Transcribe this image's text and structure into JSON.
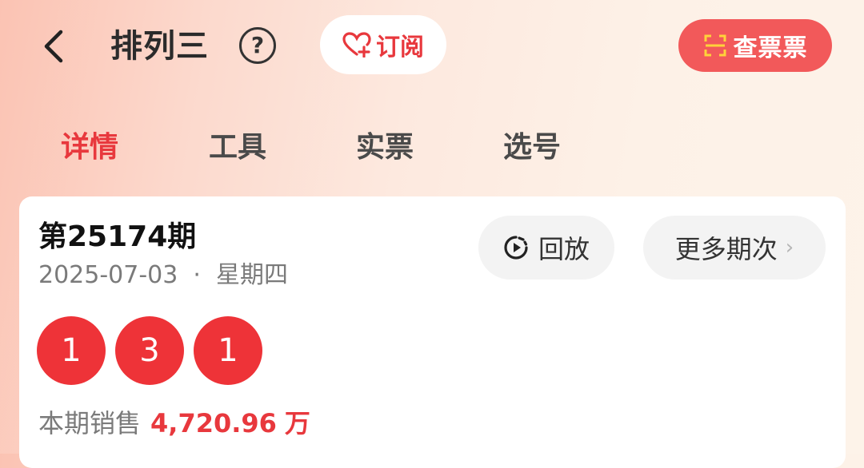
{
  "header": {
    "title": "排列三",
    "help": "?",
    "subscribe_label": "订阅",
    "check_ticket_label": "查票票"
  },
  "tabs": [
    {
      "label": "详情",
      "active": true
    },
    {
      "label": "工具",
      "active": false
    },
    {
      "label": "实票",
      "active": false
    },
    {
      "label": "选号",
      "active": false
    }
  ],
  "draw": {
    "issue": "第25174期",
    "date": "2025-07-03  ·  星期四",
    "replay_label": "回放",
    "more_label": "更多期次",
    "numbers": [
      "1",
      "3",
      "1"
    ],
    "sales_label": "本期销售",
    "sales_amount": "4,720.96",
    "sales_unit": "万"
  },
  "colors": {
    "accent_red": "#e8383d",
    "ball_red": "#ee3338",
    "check_ticket_bg": "#f2595a"
  }
}
